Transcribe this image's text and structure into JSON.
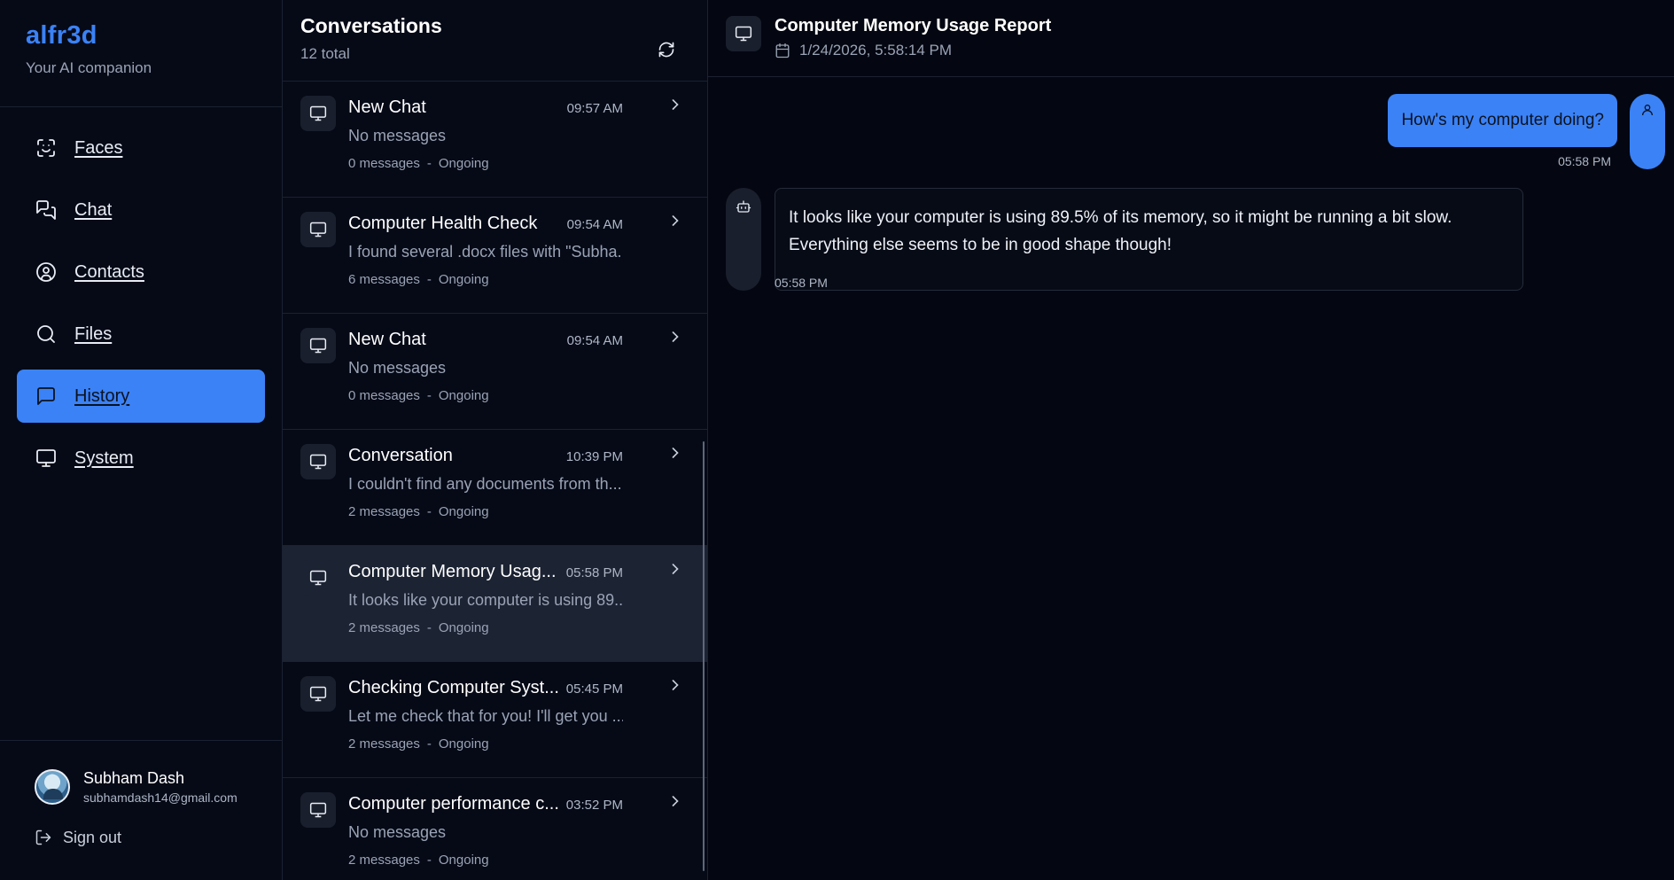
{
  "brand": {
    "name": "alfr3d",
    "tagline": "Your AI companion"
  },
  "nav": {
    "items": [
      {
        "label": "Faces",
        "icon": "face-scan-icon",
        "active": false
      },
      {
        "label": "Chat",
        "icon": "chat-bubbles-icon",
        "active": false
      },
      {
        "label": "Contacts",
        "icon": "user-circle-icon",
        "active": false
      },
      {
        "label": "Files",
        "icon": "search-icon",
        "active": false
      },
      {
        "label": "History",
        "icon": "message-square-icon",
        "active": true
      },
      {
        "label": "System",
        "icon": "monitor-icon",
        "active": false
      }
    ]
  },
  "user": {
    "name": "Subham Dash",
    "email": "subhamdash14@gmail.com",
    "signout_label": "Sign out"
  },
  "conversations": {
    "title": "Conversations",
    "count_label": "12 total",
    "items": [
      {
        "title": "New Chat",
        "time": "09:57 AM",
        "preview": "No messages",
        "messages": "0 messages",
        "status": "Ongoing"
      },
      {
        "title": "Computer Health Check",
        "time": "09:54 AM",
        "preview": "I found several .docx files with \"Subha...",
        "messages": "6 messages",
        "status": "Ongoing"
      },
      {
        "title": "New Chat",
        "time": "09:54 AM",
        "preview": "No messages",
        "messages": "0 messages",
        "status": "Ongoing"
      },
      {
        "title": "Conversation",
        "time": "10:39 PM",
        "preview": "I couldn't find any documents from th...",
        "messages": "2 messages",
        "status": "Ongoing"
      },
      {
        "title": "Computer Memory Usag...",
        "time": "05:58 PM",
        "preview": "It looks like your computer is using 89...",
        "messages": "2 messages",
        "status": "Ongoing"
      },
      {
        "title": "Checking Computer Syst...",
        "time": "05:45 PM",
        "preview": "Let me check that for you! I'll get you ...",
        "messages": "2 messages",
        "status": "Ongoing"
      },
      {
        "title": "Computer performance c...",
        "time": "03:52 PM",
        "preview": "No messages",
        "messages": "2 messages",
        "status": "Ongoing"
      }
    ]
  },
  "chat": {
    "title": "Computer Memory Usage Report",
    "date": "1/24/2026, 5:58:14 PM",
    "messages": [
      {
        "role": "user",
        "text": "How's my computer doing?",
        "time": "05:58 PM"
      },
      {
        "role": "assistant",
        "text": "It looks like your computer is using 89.5% of its memory, so it might be running a bit slow. Everything else seems to be in good shape though!",
        "time": "05:58 PM"
      }
    ]
  },
  "colors": {
    "accent": "#3b82f6",
    "background": "#05070f",
    "selected_row": "#1c2333"
  }
}
